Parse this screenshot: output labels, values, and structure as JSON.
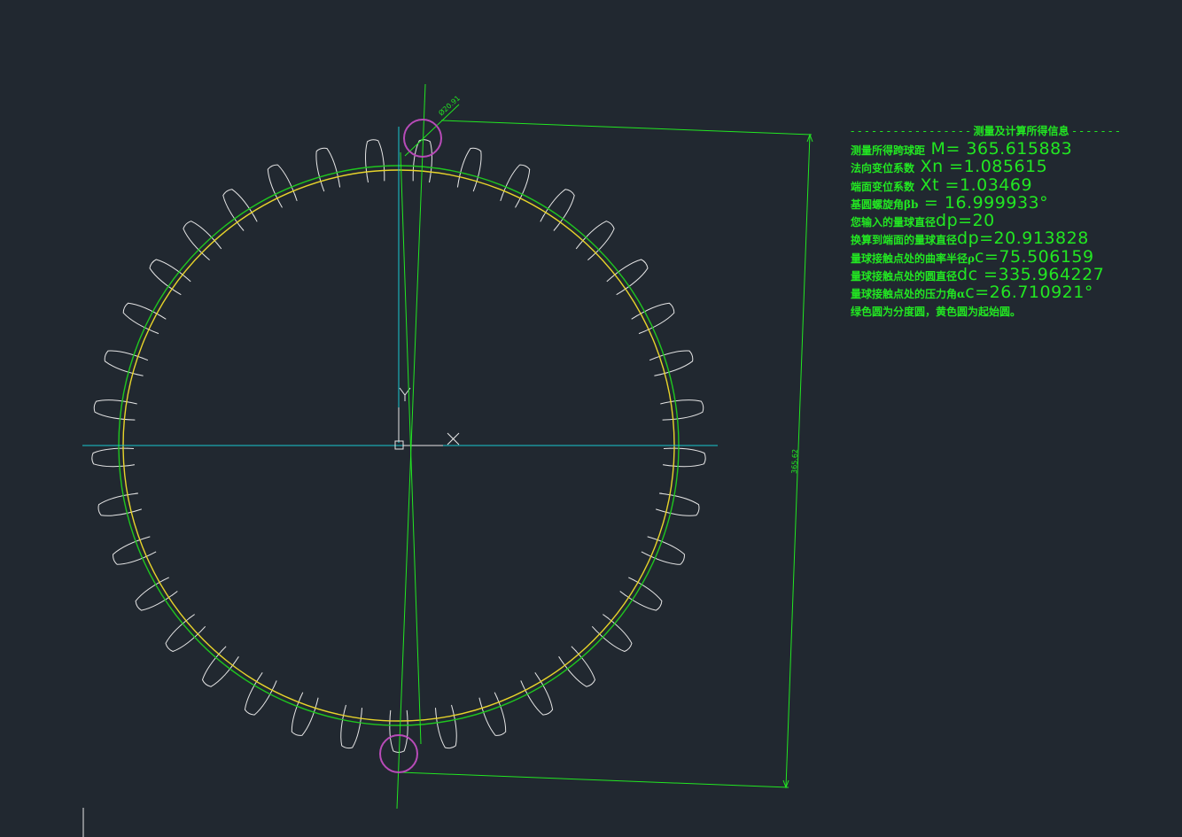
{
  "drawing": {
    "gear": {
      "teeth": 37
    },
    "axes": {
      "x_label": "X",
      "y_label": "Y"
    },
    "dimensions": {
      "ball_diameter_label": "Ø20.91",
      "span_label": "365.62"
    },
    "colors": {
      "background": "#212830",
      "tooth_profile": "#e6e6e6",
      "pitch_circle": "#1fc61f",
      "start_circle": "#e8d42a",
      "center_lines": "#19c8d0",
      "dimension": "#22e622",
      "ball": "#b84bb8"
    }
  },
  "info": {
    "header_dashes_left": "- - - - - - - - - - - - - - - - -",
    "header_title": "测量及计算所得信息",
    "header_dashes_right": "- - - - - - -",
    "rows": [
      {
        "label": "测量所得跨球距",
        "value": " M=  365.615883"
      },
      {
        "label": "法向变位系数",
        "value": " Xn  =1.085615"
      },
      {
        "label": "端面变位系数",
        "value": " Xt  =1.03469"
      },
      {
        "label": "基圆螺旋角βb",
        "value": "  =  16.999933°"
      },
      {
        "label": "您输入的量球直径",
        "value": "dp=20"
      },
      {
        "label": "换算到端面的量球直径",
        "value": "dp=20.913828"
      },
      {
        "label": "量球接触点处的曲率半径ρ",
        "value": "c=75.506159"
      },
      {
        "label": "量球接触点处的圆直径",
        "value": "dc  =335.964227"
      },
      {
        "label": "量球接触点处的压力角α",
        "value": "c=26.710921°"
      }
    ],
    "note": "绿色圆为分度圆，黄色圆为起始圆。"
  }
}
